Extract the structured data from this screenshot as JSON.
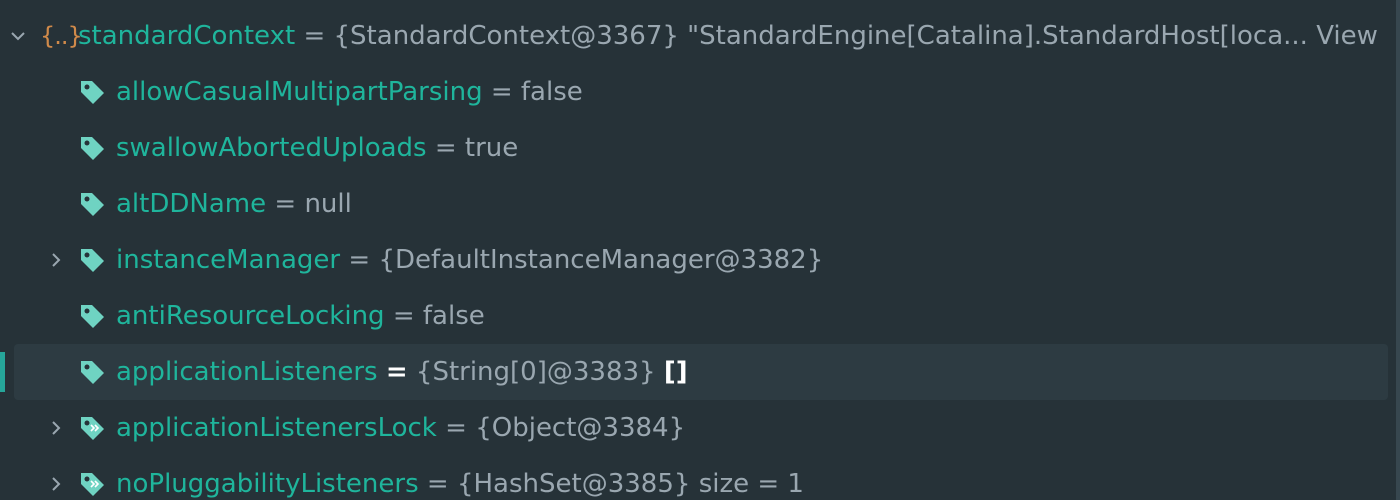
{
  "root": {
    "icon": "struct-icon",
    "icon_text": "{..}",
    "name": "standardContext",
    "op": "=",
    "value": "{StandardContext@3367} \"StandardEngine[Catalina].StandardHost[loca...",
    "view_link": "View",
    "expanded": true
  },
  "fields": [
    {
      "name": "allowCasualMultipartParsing",
      "op": "=",
      "value": "false",
      "expandable": false,
      "icon": "field-tag-icon"
    },
    {
      "name": "swallowAbortedUploads",
      "op": "=",
      "value": "true",
      "expandable": false,
      "icon": "field-tag-icon"
    },
    {
      "name": "altDDName",
      "op": "=",
      "value": "null",
      "expandable": false,
      "icon": "field-tag-icon"
    },
    {
      "name": "instanceManager",
      "op": "=",
      "value": "{DefaultInstanceManager@3382}",
      "expandable": true,
      "icon": "field-tag-icon"
    },
    {
      "name": "antiResourceLocking",
      "op": "=",
      "value": "false",
      "expandable": false,
      "icon": "field-tag-icon"
    },
    {
      "name": "applicationListeners",
      "op": "=",
      "value": "{String[0]@3383}",
      "extra": "[]",
      "expandable": false,
      "selected": true,
      "icon": "field-tag-icon"
    },
    {
      "name": "applicationListenersLock",
      "op": "=",
      "value": "{Object@3384}",
      "expandable": true,
      "icon": "final-field-tag-icon"
    },
    {
      "name": "noPluggabilityListeners",
      "op": "=",
      "value": "{HashSet@3385}",
      "extra": "size = 1",
      "expandable": true,
      "icon": "final-field-tag-icon"
    }
  ],
  "colors": {
    "background": "#263238",
    "field_name": "#1fb59c",
    "value_text": "#9aa7b0",
    "selection_bg": "#2d3b42",
    "selection_bar": "#26a69a",
    "struct_icon": "#d08a4a"
  }
}
